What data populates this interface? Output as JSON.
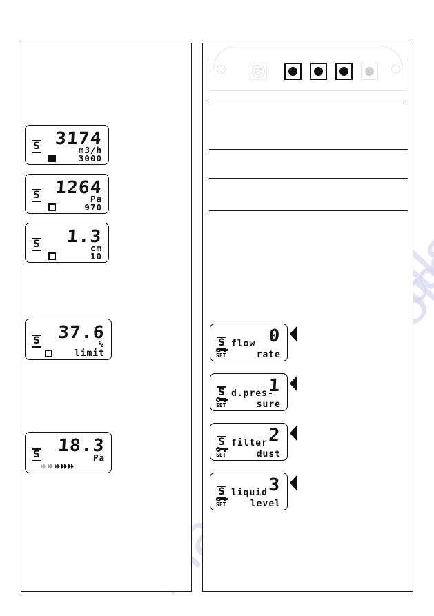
{
  "page": {
    "watermark": "manualslive.com"
  },
  "device_panel": {
    "name": "controller-front-panel",
    "buttons": [
      {
        "id": "power",
        "style": "power-faint",
        "icon": "power-icon"
      },
      {
        "id": "button-1",
        "style": "dark",
        "icon": "round-button-icon"
      },
      {
        "id": "button-2",
        "style": "dark",
        "icon": "round-button-icon"
      },
      {
        "id": "button-3",
        "style": "dark",
        "icon": "round-button-icon"
      },
      {
        "id": "button-4",
        "style": "faint",
        "icon": "round-button-icon"
      }
    ],
    "screws": [
      "screw-left",
      "screw-right"
    ]
  },
  "left_column": {
    "displays": [
      {
        "id": "flow-rate-display",
        "value": "3174",
        "unit": "m3/h",
        "indicator": "filled",
        "setpoint": "3000",
        "s_logo": "S"
      },
      {
        "id": "differential-pressure-display",
        "value": "1264",
        "unit": "Pa",
        "indicator": "O",
        "setpoint": "970",
        "s_logo": "S"
      },
      {
        "id": "liquid-level-display",
        "value": "1.3",
        "unit": "cm",
        "indicator": "O",
        "setpoint": "10",
        "s_logo": "S"
      },
      {
        "id": "filter-dust-limit-display",
        "value": "37.6",
        "unit": "%",
        "indicator": "O",
        "setpoint": "limit",
        "s_logo": "S"
      },
      {
        "id": "pressure-trend-display",
        "value": "18.3",
        "unit": "Pa",
        "indicator": "chevrons",
        "setpoint": "",
        "s_logo": "S"
      }
    ]
  },
  "right_column": {
    "menu_displays": [
      {
        "id": "menu-flow-rate",
        "value": "0",
        "line1": "flow",
        "line2": "rate",
        "s_logo": "S",
        "set_label": "SET",
        "pointer": "left-triangle"
      },
      {
        "id": "menu-d-pressure",
        "value": "1",
        "line1": "d.pres-",
        "line2": "sure",
        "s_logo": "S",
        "set_label": "SET",
        "pointer": "left-triangle"
      },
      {
        "id": "menu-filter-dust",
        "value": "2",
        "line1": "filter",
        "line2": "dust",
        "s_logo": "S",
        "set_label": "SET",
        "pointer": "left-triangle"
      },
      {
        "id": "menu-liquid-level",
        "value": "3",
        "line1": "liquid",
        "line2": "level",
        "s_logo": "S",
        "set_label": "SET",
        "pointer": "left-triangle"
      }
    ],
    "table_rules": 4
  }
}
